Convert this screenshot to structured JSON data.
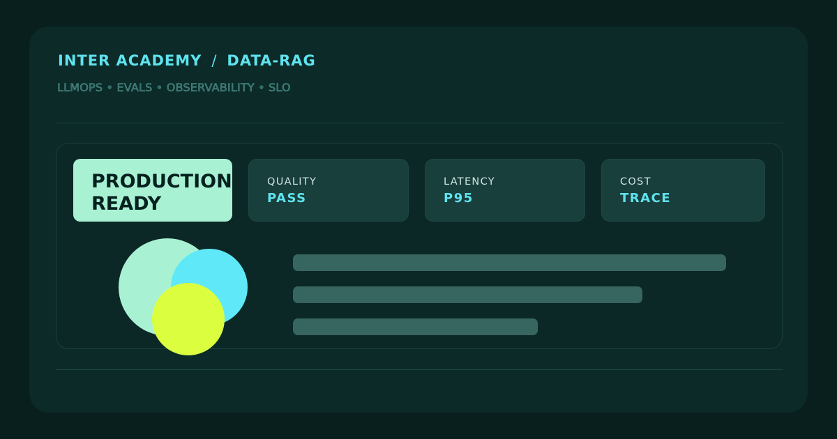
{
  "header": {
    "brand": "INTER ACADEMY",
    "separator": "/",
    "course": "DATA-RAG",
    "tags": "LLMOPS • EVALS • OBSERVABILITY • SLO"
  },
  "hero": {
    "line1": "PRODUCTION",
    "line2": "READY"
  },
  "metrics": [
    {
      "label": "QUALITY",
      "value": "PASS"
    },
    {
      "label": "LATENCY",
      "value": "P95"
    },
    {
      "label": "COST",
      "value": "TRACE"
    }
  ],
  "colors": {
    "accent_cyan": "#5fe3ee",
    "mint": "#a8f2d3",
    "lime": "#dbff3f",
    "background": "#081f1d",
    "card": "#0b2a28"
  },
  "placeholder_bars": 3
}
